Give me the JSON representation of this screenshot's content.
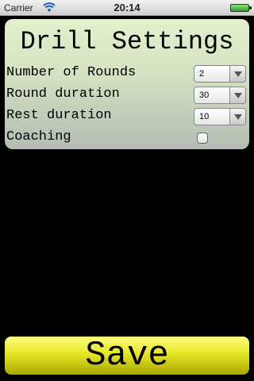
{
  "status_bar": {
    "carrier": "Carrier",
    "time": "20:14",
    "wifi_icon": "wifi-icon",
    "battery_icon": "battery-icon"
  },
  "settings": {
    "title": "Drill Settings",
    "rounds": {
      "label": "Number of Rounds",
      "value": "2"
    },
    "round_duration": {
      "label": "Round duration",
      "value": "30"
    },
    "rest_duration": {
      "label": "Rest duration",
      "value": "10"
    },
    "coaching": {
      "label": "Coaching",
      "checked": false
    }
  },
  "actions": {
    "save_label": "Save"
  },
  "colors": {
    "panel_top": "#e2f1cc",
    "panel_bottom": "#b3bdb3",
    "save_top": "#ffff80",
    "save_bottom": "#a8a800"
  }
}
